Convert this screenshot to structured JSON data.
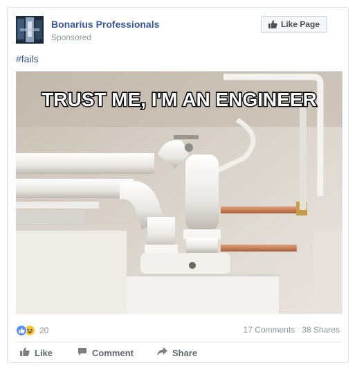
{
  "post": {
    "page_name": "Bonarius Professionals",
    "sponsored_label": "Sponsored",
    "like_page_label": "Like Page",
    "text": "#fails",
    "image_caption": "TRUST ME, I'M AN ENGINEER"
  },
  "reactions": {
    "count": "20",
    "icons": [
      "like-icon",
      "haha-icon"
    ]
  },
  "stats": {
    "comments": "17 Comments",
    "shares": "38 Shares"
  },
  "actions": {
    "like": "Like",
    "comment": "Comment",
    "share": "Share"
  },
  "colors": {
    "link": "#365899",
    "muted": "#90949c",
    "like_blue": "#5890ff",
    "haha_yellow": "#f7c439"
  }
}
